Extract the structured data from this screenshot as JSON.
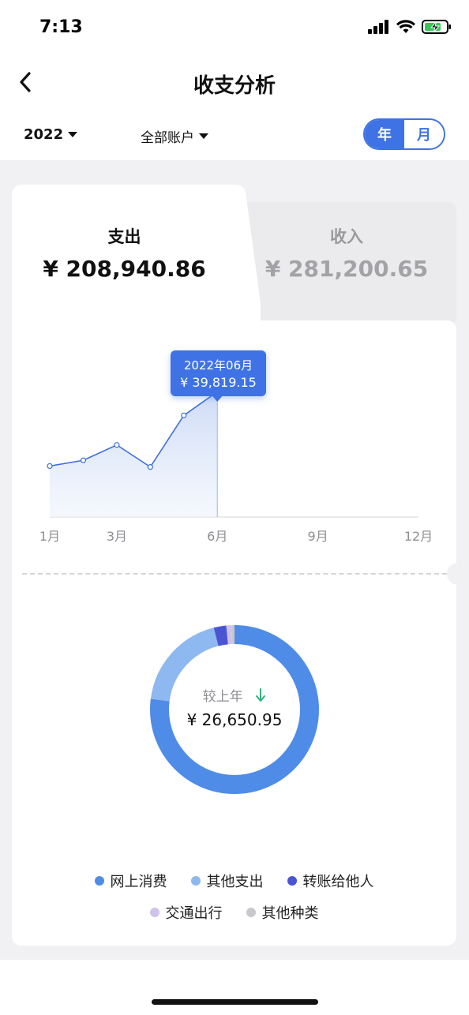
{
  "status_bar": {
    "time": "7:13"
  },
  "nav": {
    "title": "收支分析",
    "back_icon": "chevron-left-icon"
  },
  "filters": {
    "year": "2022",
    "account": "全部账户",
    "toggle": [
      {
        "label": "年",
        "active": true
      },
      {
        "label": "月",
        "active": false
      }
    ]
  },
  "tabs": {
    "expense": {
      "label": "支出",
      "amount": "¥ 208,940.86",
      "active": true
    },
    "income": {
      "label": "收入",
      "amount": "¥ 281,200.65",
      "active": false
    }
  },
  "chart_data": [
    {
      "type": "line",
      "x": [
        "1月",
        "2月",
        "3月",
        "4月",
        "5月",
        "6月"
      ],
      "values": [
        16200,
        18000,
        22900,
        15900,
        32300,
        39819.15
      ],
      "x_axis_ticks": [
        "1月",
        "3月",
        "6月",
        "9月",
        "12月"
      ],
      "x_range_months": [
        1,
        12
      ],
      "ylim": [
        0,
        64000
      ],
      "selected_point": {
        "date": "2022年06月",
        "value": "¥ 39,819.15",
        "index": 5
      },
      "fill": true,
      "colors": {
        "line": "#3f6fd8",
        "fill": "#dfe7f8",
        "tooltip": "#3f72e4"
      }
    },
    {
      "type": "pie",
      "donut": true,
      "center_label": "较上年",
      "center_value": "¥ 26,650.95",
      "trend": "down",
      "slices": [
        {
          "name": "网上消费",
          "value": 77,
          "color": "#4e8ce8"
        },
        {
          "name": "其他支出",
          "value": 19,
          "color": "#8db8f0"
        },
        {
          "name": "转账给他人",
          "value": 2.4,
          "color": "#4a55d4"
        },
        {
          "name": "交通出行",
          "value": 1.0,
          "color": "#cfc3e8"
        },
        {
          "name": "其他种类",
          "value": 0.6,
          "color": "#c8c8cc"
        }
      ]
    }
  ],
  "legend": {
    "row1": [
      {
        "name": "网上消费",
        "color": "#4e8ce8"
      },
      {
        "name": "其他支出",
        "color": "#8db8f0"
      },
      {
        "name": "转账给他人",
        "color": "#4a55d4"
      }
    ],
    "row2": [
      {
        "name": "交通出行",
        "color": "#cfc3e8"
      },
      {
        "name": "其他种类",
        "color": "#c8c8cc"
      }
    ]
  },
  "colors": {
    "accent": "#3f72e4",
    "background": "#f1f1f3",
    "trend_down": "#2fb37f"
  }
}
